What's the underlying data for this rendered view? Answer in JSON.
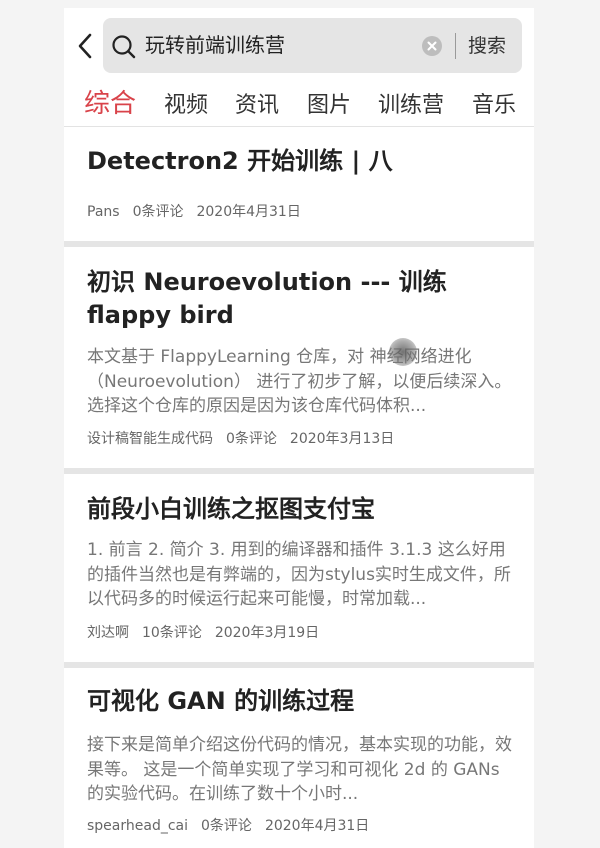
{
  "search": {
    "query": "玩转前端训练营",
    "button_label": "搜索"
  },
  "tabs": [
    {
      "label": "综合",
      "active": true
    },
    {
      "label": "视频",
      "active": false
    },
    {
      "label": "资讯",
      "active": false
    },
    {
      "label": "图片",
      "active": false
    },
    {
      "label": "训练营",
      "active": false
    },
    {
      "label": "音乐",
      "active": false
    }
  ],
  "articles": [
    {
      "title": "Detectron2 开始训练 | 八",
      "summary": "",
      "author": "Pans",
      "comments": "0条评论",
      "date": "2020年4月31日"
    },
    {
      "title": "初识 Neuroevolution --- 训练 flappy bird",
      "summary": "本文基于 FlappyLearning 仓库，对 神经网络进化（Neuroevolution） 进行了初步了解，以便后续深入。选择这个仓库的原因是因为该仓库代码体积...",
      "author": "设计稿智能生成代码",
      "comments": "0条评论",
      "date": "2020年3月13日"
    },
    {
      "title": "前段小白训练之抠图支付宝",
      "summary": "1. 前言 2. 简介 3. 用到的编译器和插件 3.1.3 这么好用的插件当然也是有弊端的，因为stylus实时生成文件，所以代码多的时候运行起来可能慢，时常加载...",
      "author": "刘达啊",
      "comments": "10条评论",
      "date": "2020年3月19日"
    },
    {
      "title": "可视化 GAN 的训练过程",
      "summary": "接下来是简单介绍这份代码的情况，基本实现的功能，效果等。 这是一个简单实现了学习和可视化 2d 的 GANs 的实验代码。在训练了数十个小时...",
      "author": "spearhead_cai",
      "comments": "0条评论",
      "date": "2020年4月31日"
    }
  ],
  "colors": {
    "accent": "#d9434a",
    "search_bg": "#e5e5e5",
    "separator": "#e5e5e5",
    "title_text": "#222222",
    "summary_text": "#777777"
  },
  "icons": {
    "back": "chevron-left-icon",
    "search": "search-icon",
    "clear": "clear-icon"
  }
}
